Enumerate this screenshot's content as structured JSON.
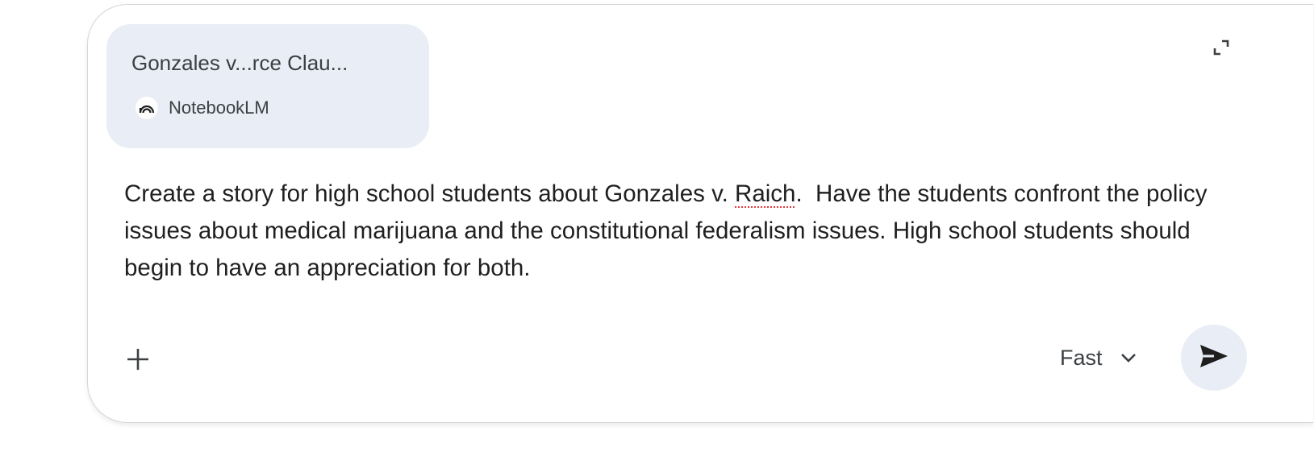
{
  "attachment": {
    "title": "Gonzales v...rce Clau...",
    "source_label": "NotebookLM",
    "source_icon": "notebooklm-icon"
  },
  "prompt": {
    "before_flagged": "Create a story for high school students about Gonzales v. ",
    "flagged_word": "Raich",
    "after_flagged": ".  Have the students confront the policy issues about medical marijuana and the constitutional federalism issues. High school students should begin to have an appreciation for both."
  },
  "toolbar": {
    "add_icon": "plus-icon",
    "expand_icon": "expand-icon",
    "mode_label": "Fast",
    "mode_icon": "chevron-down-icon",
    "send_icon": "send-icon"
  },
  "colors": {
    "chip_background": "#e9edf5",
    "send_background": "#e9edf5",
    "spellcheck_underline": "#e5393c",
    "text_primary": "#1f1f1f"
  }
}
